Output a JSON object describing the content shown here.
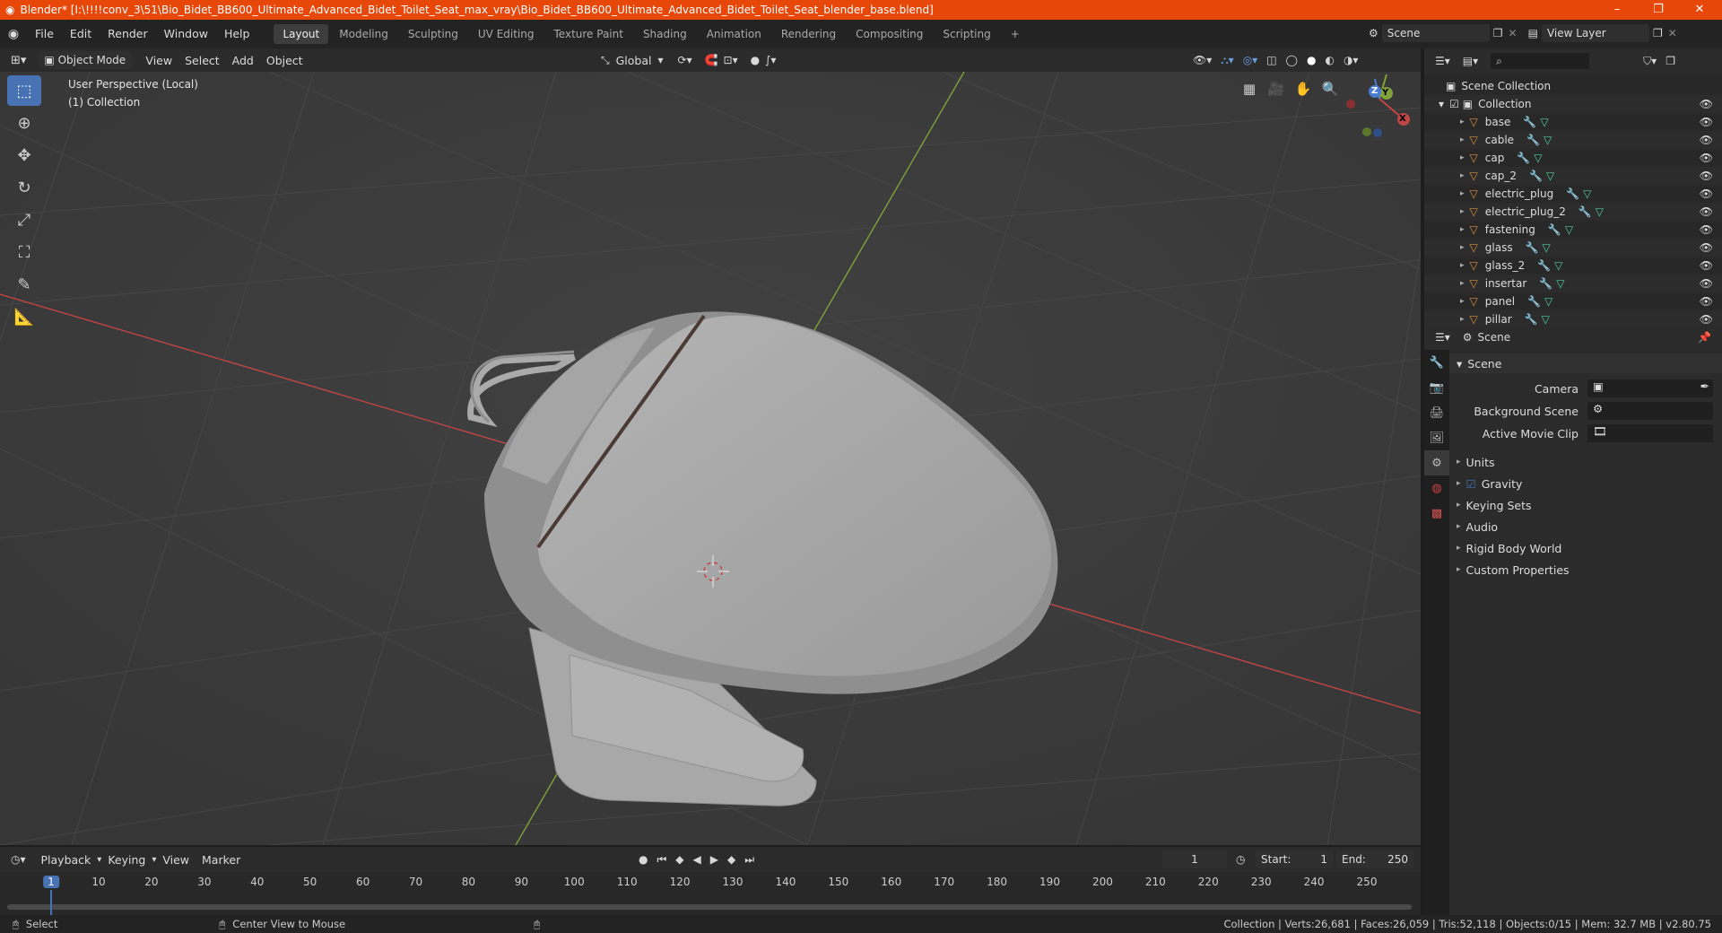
{
  "window": {
    "title": "Blender* [I:\\!!!!conv_3\\51\\Bio_Bidet_BB600_Ultimate_Advanced_Bidet_Toilet_Seat_max_vray\\Bio_Bidet_BB600_Ultimate_Advanced_Bidet_Toilet_Seat_blender_base.blend]",
    "minimize": "–",
    "maximize": "❐",
    "close": "✕"
  },
  "menubar": {
    "items": [
      "File",
      "Edit",
      "Render",
      "Window",
      "Help"
    ],
    "workspaces": [
      "Layout",
      "Modeling",
      "Sculpting",
      "UV Editing",
      "Texture Paint",
      "Shading",
      "Animation",
      "Rendering",
      "Compositing",
      "Scripting"
    ],
    "add_workspace": "+",
    "scene_label": "Scene",
    "view_layer_label": "View Layer"
  },
  "viewport_header": {
    "mode": "Object Mode",
    "menus": [
      "View",
      "Select",
      "Add",
      "Object"
    ],
    "orientation": "Global"
  },
  "viewport": {
    "perspective_label": "User Perspective (Local)",
    "collection_label": "(1) Collection",
    "gizmo_axes": {
      "x": "X",
      "y": "Y",
      "z": "Z"
    }
  },
  "outliner": {
    "root": "Scene Collection",
    "collection": "Collection",
    "objects": [
      "base",
      "cable",
      "cap",
      "cap_2",
      "electric_plug",
      "electric_plug_2",
      "fastening",
      "glass",
      "glass_2",
      "insertar",
      "panel",
      "pillar"
    ]
  },
  "properties": {
    "header": "Scene",
    "panel_title": "Scene",
    "fields": [
      {
        "label": "Camera"
      },
      {
        "label": "Background Scene"
      },
      {
        "label": "Active Movie Clip"
      }
    ],
    "sections": [
      "Units",
      "Gravity",
      "Keying Sets",
      "Audio",
      "Rigid Body World",
      "Custom Properties"
    ]
  },
  "timeline": {
    "menus": [
      "Playback",
      "Keying",
      "View",
      "Marker"
    ],
    "current_frame": "1",
    "start_label": "Start:",
    "start": "1",
    "end_label": "End:",
    "end": "250",
    "ticks": [
      "1",
      "10",
      "20",
      "30",
      "40",
      "50",
      "60",
      "70",
      "80",
      "90",
      "100",
      "110",
      "120",
      "130",
      "140",
      "150",
      "160",
      "170",
      "180",
      "190",
      "200",
      "210",
      "220",
      "230",
      "240",
      "250"
    ]
  },
  "statusbar": {
    "left": "Select",
    "middle": "Center View to Mouse",
    "stats": "Collection | Verts:26,681 | Faces:26,059 | Tris:52,118 | Objects:0/15 | Mem: 32.7 MB | v2.80.75"
  },
  "colors": {
    "titlebar": "#e8470a",
    "accent": "#4772b3",
    "x_axis": "#c04545",
    "y_axis": "#7fa23a"
  }
}
